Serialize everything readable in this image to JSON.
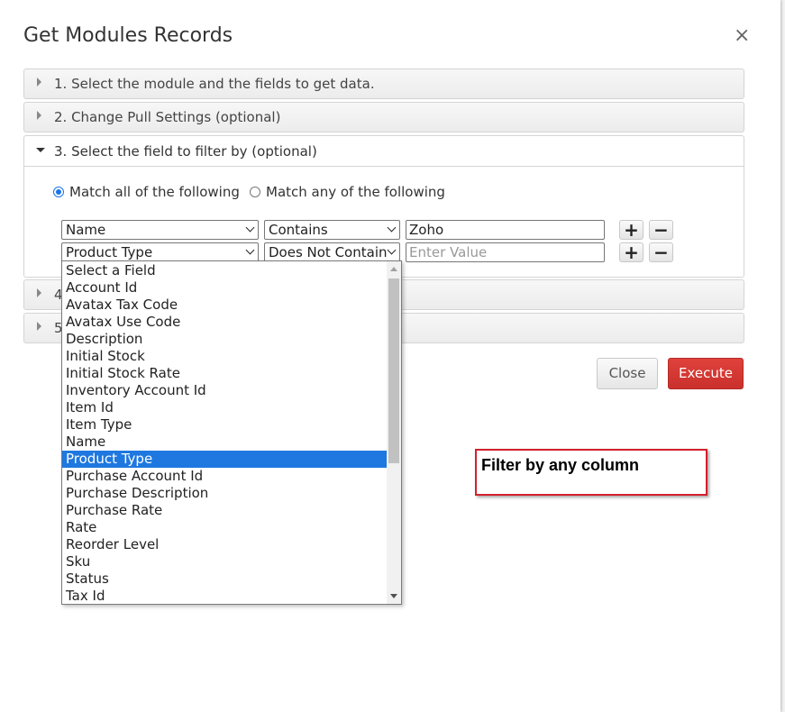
{
  "dialog": {
    "title": "Get Modules Records",
    "close_icon": "close-icon",
    "close_glyph": "×"
  },
  "sections": [
    {
      "label": "1. Select the module and the fields to get data."
    },
    {
      "label": "2. Change Pull Settings (optional)"
    },
    {
      "label": "3. Select the field to filter by (optional)"
    },
    {
      "label": "4"
    },
    {
      "label": "5"
    }
  ],
  "filter": {
    "match_all_label": "Match all of the following",
    "match_any_label": "Match any of the following",
    "match_mode": "all",
    "rows": [
      {
        "field": "Name",
        "operator": "Contains",
        "value": "Zoho",
        "placeholder": ""
      },
      {
        "field": "Product Type",
        "operator": "Does Not Contain",
        "value": "",
        "placeholder": "Enter Value"
      }
    ],
    "add_label": "+",
    "remove_label": "−"
  },
  "dropdown": {
    "selected": "Product Type",
    "options": [
      "Select a Field",
      "Account Id",
      "Avatax Tax Code",
      "Avatax Use Code",
      "Description",
      "Initial Stock",
      "Initial Stock Rate",
      "Inventory Account Id",
      "Item Id",
      "Item Type",
      "Name",
      "Product Type",
      "Purchase Account Id",
      "Purchase Description",
      "Purchase Rate",
      "Rate",
      "Reorder Level",
      "Sku",
      "Status",
      "Tax Id"
    ]
  },
  "buttons": {
    "close_label": "Close",
    "execute_label": "Execute"
  },
  "callout": {
    "text": "Filter by any column"
  },
  "colors": {
    "accent": "#1e78e0",
    "execute": "#d9534f",
    "callout_border": "#d3212d"
  }
}
